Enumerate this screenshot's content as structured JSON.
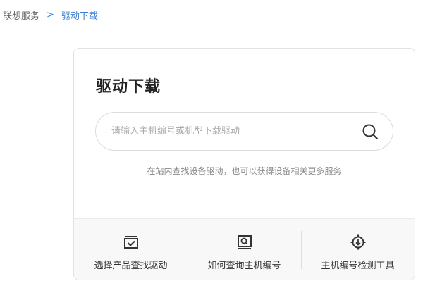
{
  "breadcrumb": {
    "root": "联想服务",
    "separator": ">",
    "current": "驱动下载"
  },
  "card": {
    "title": "驱动下载",
    "search": {
      "placeholder": "请输入主机编号或机型下载驱动",
      "value": "",
      "icon": "search-icon"
    },
    "hint": "在站内查找设备驱动，也可以获得设备相关更多服务"
  },
  "tools": [
    {
      "label": "选择产品查找驱动",
      "icon": "checkbox-monitor-icon"
    },
    {
      "label": "如何查询主机编号",
      "icon": "search-monitor-icon"
    },
    {
      "label": "主机编号检测工具",
      "icon": "target-download-icon"
    }
  ],
  "colors": {
    "accent": "#3d7fd6",
    "text": "#333333",
    "hint": "#8a8a8a",
    "border": "#e2e2e2",
    "tools_bg": "#f8f8f8"
  }
}
